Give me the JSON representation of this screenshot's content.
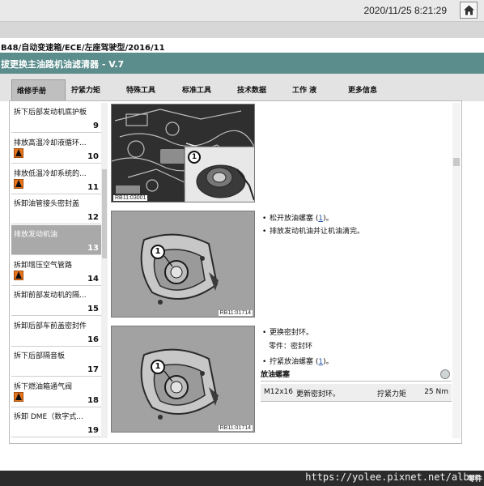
{
  "header": {
    "datetime": "2020/11/25 8:21:29",
    "home_icon": "home-icon"
  },
  "breadcrumb": "B48/自动变速箱/ECE/左座驾驶型/2016/11",
  "title": "拔更换主油路机油滤清器 - V.7",
  "tabs": [
    "维修手册",
    "拧紧力矩",
    "特殊工具",
    "标准工具",
    "技术数据",
    "工作 液",
    "更多信息"
  ],
  "steps": [
    {
      "label": "拆下后部发动机底护板",
      "number": "9",
      "warning": false
    },
    {
      "label": "排放高温冷却液循环...",
      "number": "10",
      "warning": true
    },
    {
      "label": "排放低温冷却系统的...",
      "number": "11",
      "warning": true
    },
    {
      "label": "拆卸油管接头密封盖",
      "number": "12",
      "warning": false
    },
    {
      "label": "排放发动机油",
      "number": "13",
      "warning": false
    },
    {
      "label": "拆卸增压空气管路",
      "number": "14",
      "warning": true
    },
    {
      "label": "拆卸前部发动机的隔...",
      "number": "15",
      "warning": false
    },
    {
      "label": "拆卸后部车前盖密封件",
      "number": "16",
      "warning": false
    },
    {
      "label": "拆下后部隔音板",
      "number": "17",
      "warning": false
    },
    {
      "label": "拆下燃油箱通气阀",
      "number": "18",
      "warning": true
    },
    {
      "label": "拆卸 DME（数字式...",
      "number": "19",
      "warning": false
    }
  ],
  "figures": [
    {
      "label": "RB11:03001",
      "callout": "1"
    },
    {
      "label": "RB11:01714",
      "callout": "1"
    },
    {
      "label": "RB11:01714",
      "callout": "1"
    }
  ],
  "instructions_1": {
    "line1_prefix": "松开放油螺塞 (",
    "line1_link": "1",
    "line1_suffix": ")。",
    "line2": "排放发动机油并让机油滴完。"
  },
  "instructions_2": {
    "line1": "更换密封环。",
    "line2": "零件：密封环",
    "line3_prefix": "拧紧放油螺塞 (",
    "line3_link": "1",
    "line3_suffix": ")。"
  },
  "torque_table": {
    "heading": "放油螺塞",
    "info_icon": "info-icon",
    "row": {
      "thread": "M12x16",
      "note": "更新密封环。",
      "type": "拧紧力矩",
      "value": "25 Nm"
    }
  },
  "bottom_fragment": "零件",
  "watermark": "https://yolee.pixnet.net/album"
}
